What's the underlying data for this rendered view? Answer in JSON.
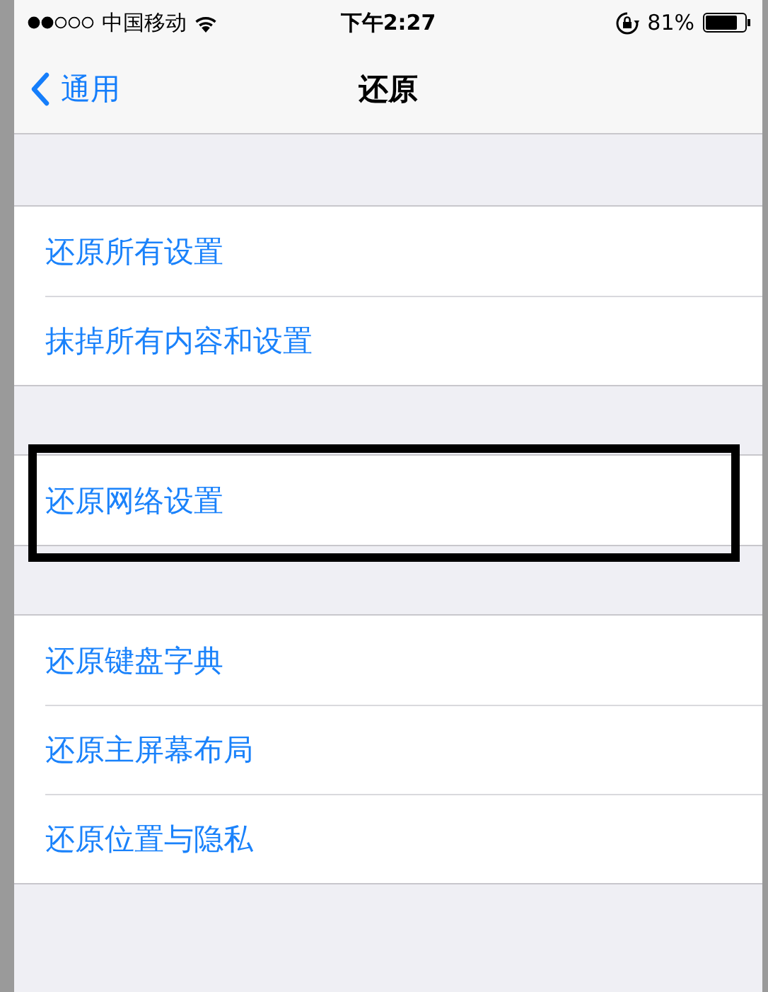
{
  "status_bar": {
    "carrier": "中国移动",
    "time": "下午2:27",
    "battery": "81%"
  },
  "nav_bar": {
    "back": "通用",
    "title": "还原"
  },
  "groups": [
    {
      "items": [
        {
          "label": "还原所有设置",
          "highlighted": false
        },
        {
          "label": "抹掉所有内容和设置",
          "highlighted": false
        }
      ]
    },
    {
      "items": [
        {
          "label": "还原网络设置",
          "highlighted": true
        }
      ]
    },
    {
      "items": [
        {
          "label": "还原键盘字典",
          "highlighted": false
        },
        {
          "label": "还原主屏幕布局",
          "highlighted": false
        },
        {
          "label": "还原位置与隐私",
          "highlighted": false
        }
      ]
    }
  ]
}
